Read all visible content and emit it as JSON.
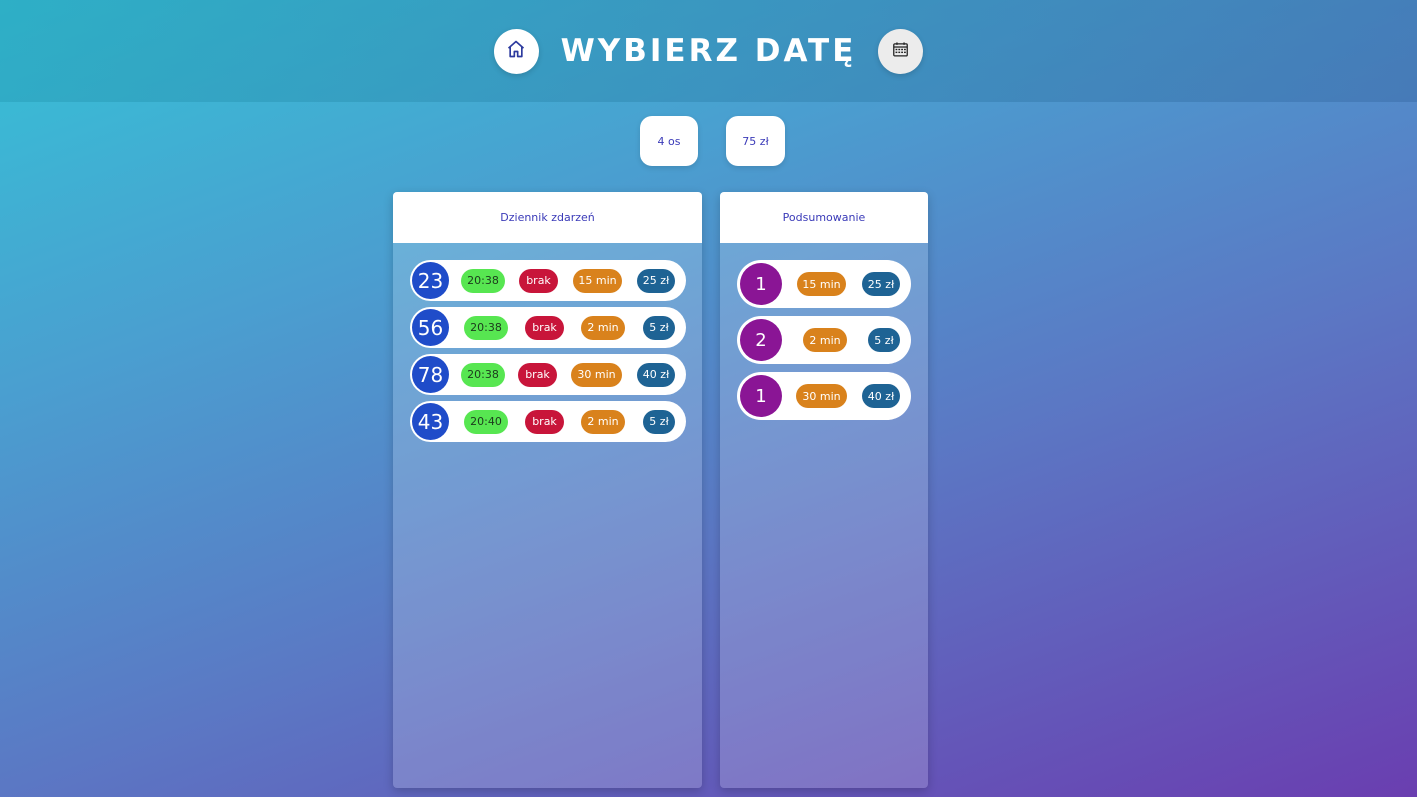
{
  "header": {
    "title": "WYBIERZ DATĘ",
    "home_icon": "home-icon",
    "calendar_icon": "calendar-icon"
  },
  "stats": {
    "people": "4 os",
    "total": "75 zł"
  },
  "log": {
    "title": "Dziennik zdarzeń",
    "rows": [
      {
        "number": "23",
        "time": "20:38",
        "status": "brak",
        "duration": "15 min",
        "price": "25 zł"
      },
      {
        "number": "56",
        "time": "20:38",
        "status": "brak",
        "duration": "2 min",
        "price": "5 zł"
      },
      {
        "number": "78",
        "time": "20:38",
        "status": "brak",
        "duration": "30 min",
        "price": "40 zł"
      },
      {
        "number": "43",
        "time": "20:40",
        "status": "brak",
        "duration": "2 min",
        "price": "5 zł"
      }
    ]
  },
  "summary": {
    "title": "Podsumowanie",
    "rows": [
      {
        "count": "1",
        "duration": "15 min",
        "price": "25 zł"
      },
      {
        "count": "2",
        "duration": "2 min",
        "price": "5 zł"
      },
      {
        "count": "1",
        "duration": "30 min",
        "price": "40 zł"
      }
    ]
  },
  "colors": {
    "number_badge": "#1f4cc9",
    "time": "#57e651",
    "status": "#c8153a",
    "duration": "#d9821c",
    "price": "#1e6394",
    "summary_badge": "#8a1595"
  }
}
